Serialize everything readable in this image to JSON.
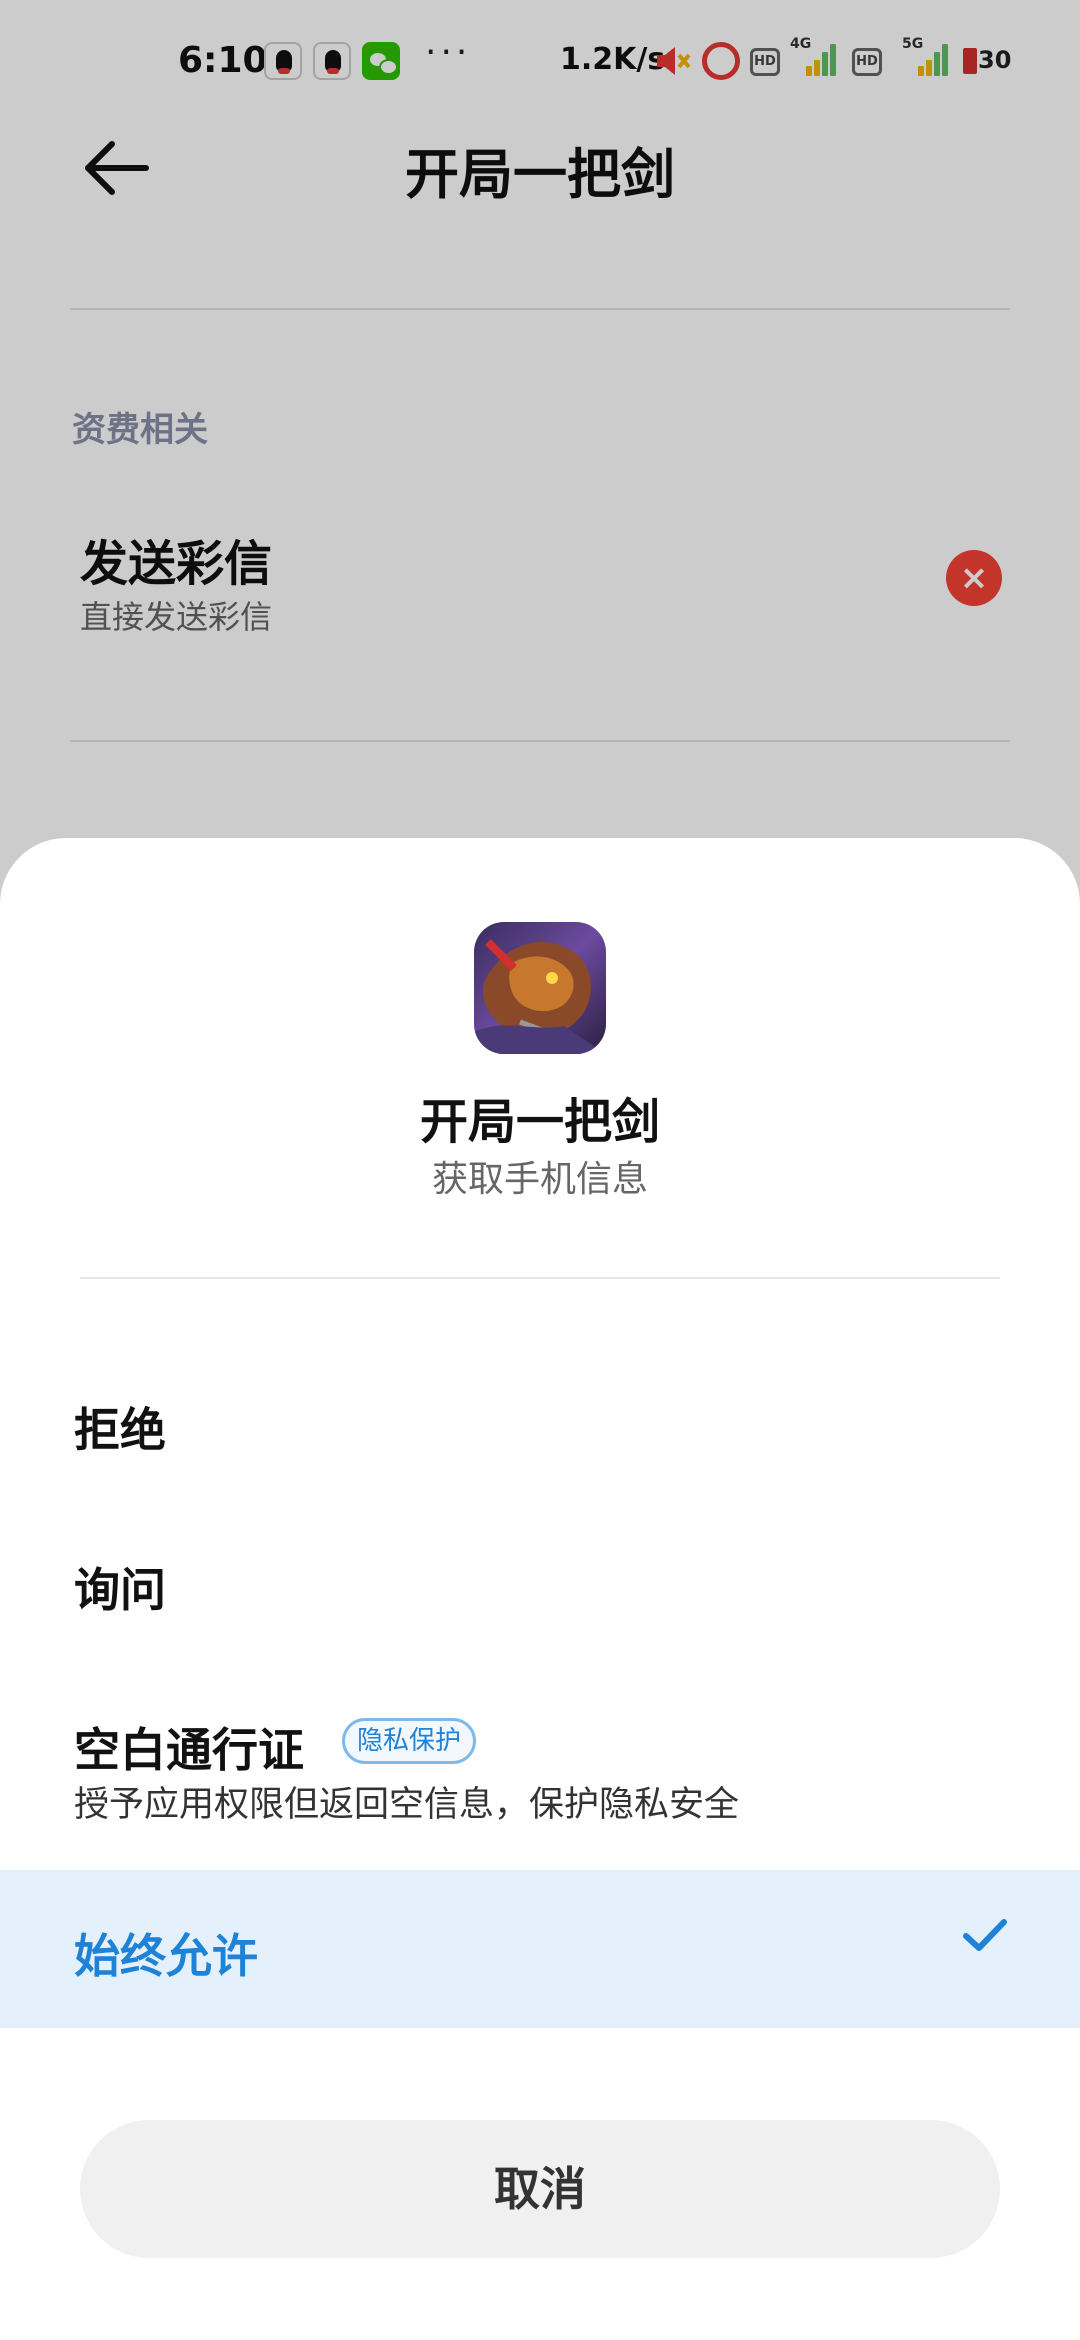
{
  "status_bar": {
    "time": "6:10",
    "more": "···",
    "net_speed": "1.2K/s",
    "hd1": "HD",
    "net1": "4G",
    "hd2": "HD",
    "net2": "5G",
    "battery": "30",
    "icons": [
      "qq-icon",
      "qq-icon",
      "wechat-icon",
      "mute-icon",
      "alarm-icon",
      "signal-icon",
      "battery-icon"
    ]
  },
  "appbar": {
    "title": "开局一把剑"
  },
  "background": {
    "section_label": "资费相关",
    "setting": {
      "title": "发送彩信",
      "subtitle": "直接发送彩信",
      "status_icon": "×"
    }
  },
  "sheet": {
    "app_name": "开局一把剑",
    "permission": "获取手机信息",
    "options": [
      {
        "label": "拒绝"
      },
      {
        "label": "询问"
      },
      {
        "label": "空白通行证",
        "badge": "隐私保护",
        "desc": "授予应用权限但返回空信息，保护隐私安全"
      },
      {
        "label": "始终允许",
        "selected": true
      }
    ],
    "cancel": "取消"
  },
  "colors": {
    "accent": "#1e82d6",
    "selected_bg": "#e4f1fd",
    "danger": "#f44336"
  }
}
